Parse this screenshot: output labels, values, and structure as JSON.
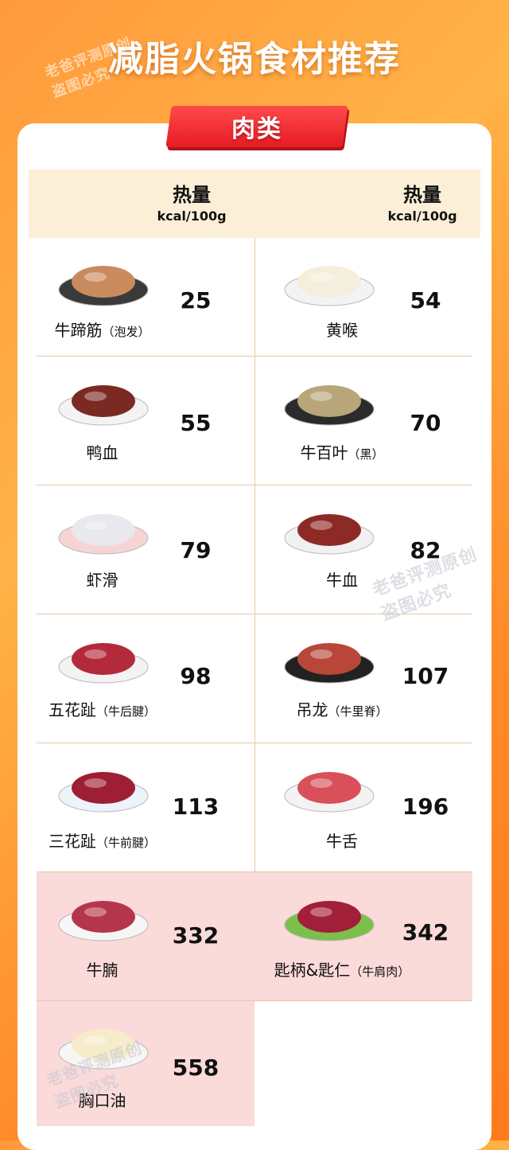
{
  "title": "减脂火锅食材推荐",
  "watermark": "老爸评测原创 盗图必究",
  "category": "肉类",
  "header": {
    "left": {
      "title": "热量",
      "unit": "kcal/100g"
    },
    "right": {
      "title": "热量",
      "unit": "kcal/100g"
    }
  },
  "colors": {
    "accent_red": "#e51c23",
    "highlight_pink": "#fbdada",
    "header_bg": "#fcefd8"
  },
  "items": [
    {
      "name": "牛蹄筋",
      "note": "（泡发）",
      "kcal": "25",
      "icon": "tendon-plate-icon",
      "highlight": false
    },
    {
      "name": "黄喉",
      "note": "",
      "kcal": "54",
      "icon": "aorta-plate-icon",
      "highlight": false
    },
    {
      "name": "鸭血",
      "note": "",
      "kcal": "55",
      "icon": "duck-blood-plate-icon",
      "highlight": false
    },
    {
      "name": "牛百叶",
      "note": "（黑）",
      "kcal": "70",
      "icon": "tripe-plate-icon",
      "highlight": false
    },
    {
      "name": "虾滑",
      "note": "",
      "kcal": "79",
      "icon": "shrimp-paste-plate-icon",
      "highlight": false
    },
    {
      "name": "牛血",
      "note": "",
      "kcal": "82",
      "icon": "beef-blood-plate-icon",
      "highlight": false
    },
    {
      "name": "五花趾",
      "note": "（牛后腱）",
      "kcal": "98",
      "icon": "beef-shank-plate-icon",
      "highlight": false
    },
    {
      "name": "吊龙",
      "note": "（牛里脊）",
      "kcal": "107",
      "icon": "tenderloin-plate-icon",
      "highlight": false
    },
    {
      "name": "三花趾",
      "note": "（牛前腱）",
      "kcal": "113",
      "icon": "fore-shank-plate-icon",
      "highlight": false
    },
    {
      "name": "牛舌",
      "note": "",
      "kcal": "196",
      "icon": "tongue-plate-icon",
      "highlight": false
    },
    {
      "name": "牛腩",
      "note": "",
      "kcal": "332",
      "icon": "brisket-plate-icon",
      "highlight": true
    },
    {
      "name": "匙柄&匙仁",
      "note": "（牛肩肉）",
      "kcal": "342",
      "icon": "chuck-plate-icon",
      "highlight": true
    },
    {
      "name": "胸口油",
      "note": "",
      "kcal": "558",
      "icon": "chest-fat-plate-icon",
      "highlight": true
    }
  ]
}
